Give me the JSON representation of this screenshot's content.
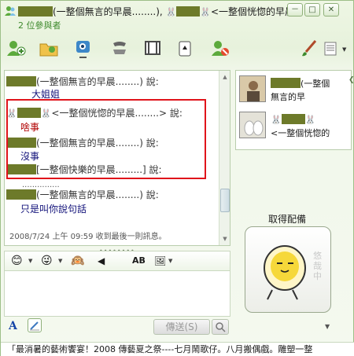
{
  "window": {
    "title_part1": "(一整個無言的早晨........),",
    "title_part2": "<一整個恍惚的早晨........",
    "participants": "2 位參與者",
    "minimize": "－",
    "maximize": "□",
    "close": "✕"
  },
  "toolbar": {
    "items": [
      "invite",
      "share-files",
      "video-call",
      "phone",
      "activities",
      "games",
      "block"
    ],
    "drop": "▼"
  },
  "chat": {
    "messages": [
      {
        "sender": "(一整個無言的早晨........) 說:",
        "text": "大姐姐"
      },
      {
        "sender": "<一整個恍惚的早晨........> 說:",
        "text": "啥事"
      },
      {
        "sender": "(一整個無言的早晨........) 說:",
        "text": "沒事"
      },
      {
        "sender": "[一整個快樂的早晨.........] 說:",
        "text": "..............."
      },
      {
        "sender": "(一整個無言的早晨........) 說:",
        "text": "只是叫你說句話"
      }
    ],
    "status": "2008/7/24 上午 09:59 收到最後一則訊息。"
  },
  "input": {
    "send_label": "傳送(S)",
    "splitter": "••••••••",
    "font_letter": "A"
  },
  "contacts": [
    {
      "name_line1": "(一整個",
      "name_line2": "無言的早"
    },
    {
      "name_line2": "<一整個恍惚的"
    }
  ],
  "avatar_panel": {
    "label": "取得配備",
    "watermark": "悠哉中"
  },
  "ticker": {
    "text": "「最消暑的藝術饗宴！2008 傳藝夏之祭----七月鬧歌仔。八月搬偶戲。雕塑一整"
  },
  "colors": {
    "accent_green": "#3f8a2e",
    "highlight_red": "#e0141b",
    "censor": "#6d7a2a"
  }
}
